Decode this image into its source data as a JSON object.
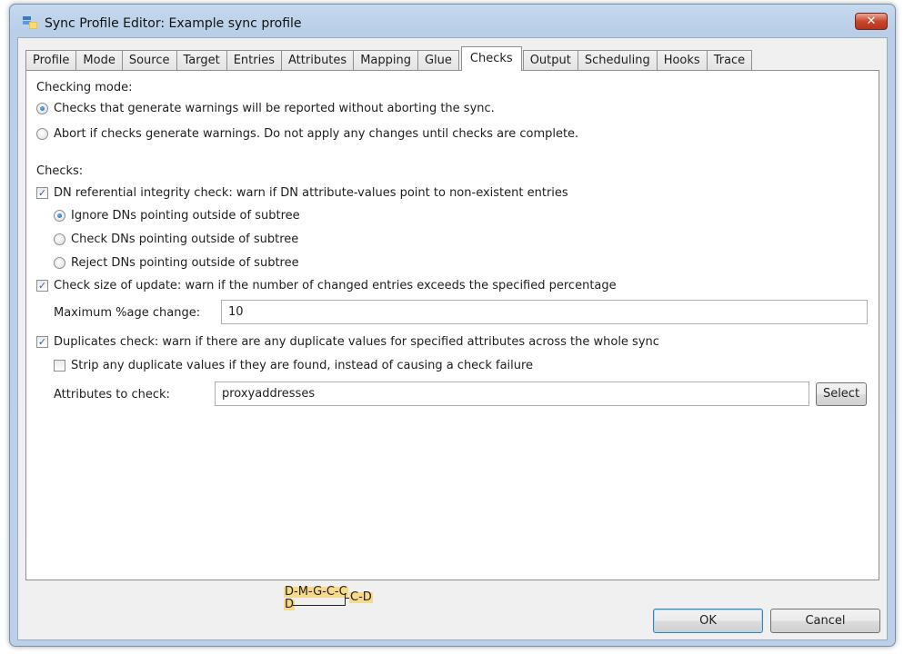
{
  "window": {
    "title": "Sync Profile Editor: Example sync profile",
    "close_label": "✕"
  },
  "tabs": [
    {
      "label": "Profile",
      "active": false
    },
    {
      "label": "Mode",
      "active": false
    },
    {
      "label": "Source",
      "active": false
    },
    {
      "label": "Target",
      "active": false
    },
    {
      "label": "Entries",
      "active": false
    },
    {
      "label": "Attributes",
      "active": false
    },
    {
      "label": "Mapping",
      "active": false
    },
    {
      "label": "Glue",
      "active": false
    },
    {
      "label": "Checks",
      "active": true
    },
    {
      "label": "Output",
      "active": false
    },
    {
      "label": "Scheduling",
      "active": false
    },
    {
      "label": "Hooks",
      "active": false
    },
    {
      "label": "Trace",
      "active": false
    }
  ],
  "checks_tab": {
    "checking_mode_label": "Checking mode:",
    "mode_options": [
      {
        "label": "Checks that generate warnings will be reported without aborting the sync.",
        "selected": true
      },
      {
        "label": "Abort if checks generate warnings.  Do not apply any changes until checks are complete.",
        "selected": false
      }
    ],
    "checks_label": "Checks:",
    "dn_check": {
      "label": "DN referential integrity check: warn if DN attribute-values point to non-existent entries",
      "checked": true
    },
    "dn_options": [
      {
        "label": "Ignore DNs pointing outside of subtree",
        "selected": true
      },
      {
        "label": "Check DNs pointing outside of subtree",
        "selected": false
      },
      {
        "label": "Reject DNs pointing outside of subtree",
        "selected": false
      }
    ],
    "size_check": {
      "label": "Check size of update: warn if the number of changed entries exceeds the specified percentage",
      "checked": true
    },
    "max_change_label": "Maximum %age change:",
    "max_change_value": "10",
    "duplicates_check": {
      "label": "Duplicates check: warn if there are any duplicate values for specified attributes across the whole sync",
      "checked": true
    },
    "strip_duplicates": {
      "label": "Strip any duplicate values if they are found, instead of causing a check failure",
      "checked": false
    },
    "attributes_label": "Attributes to check:",
    "attributes_value": "proxyaddresses",
    "select_label": "Select"
  },
  "diagram": {
    "top": "D-M-G-C-C",
    "bottom": "D",
    "right": "C-D"
  },
  "footer": {
    "ok_label": "OK",
    "cancel_label": "Cancel"
  },
  "colors": {
    "accent": "#3c7fb1",
    "diagram_highlight": "#f7d98b"
  }
}
